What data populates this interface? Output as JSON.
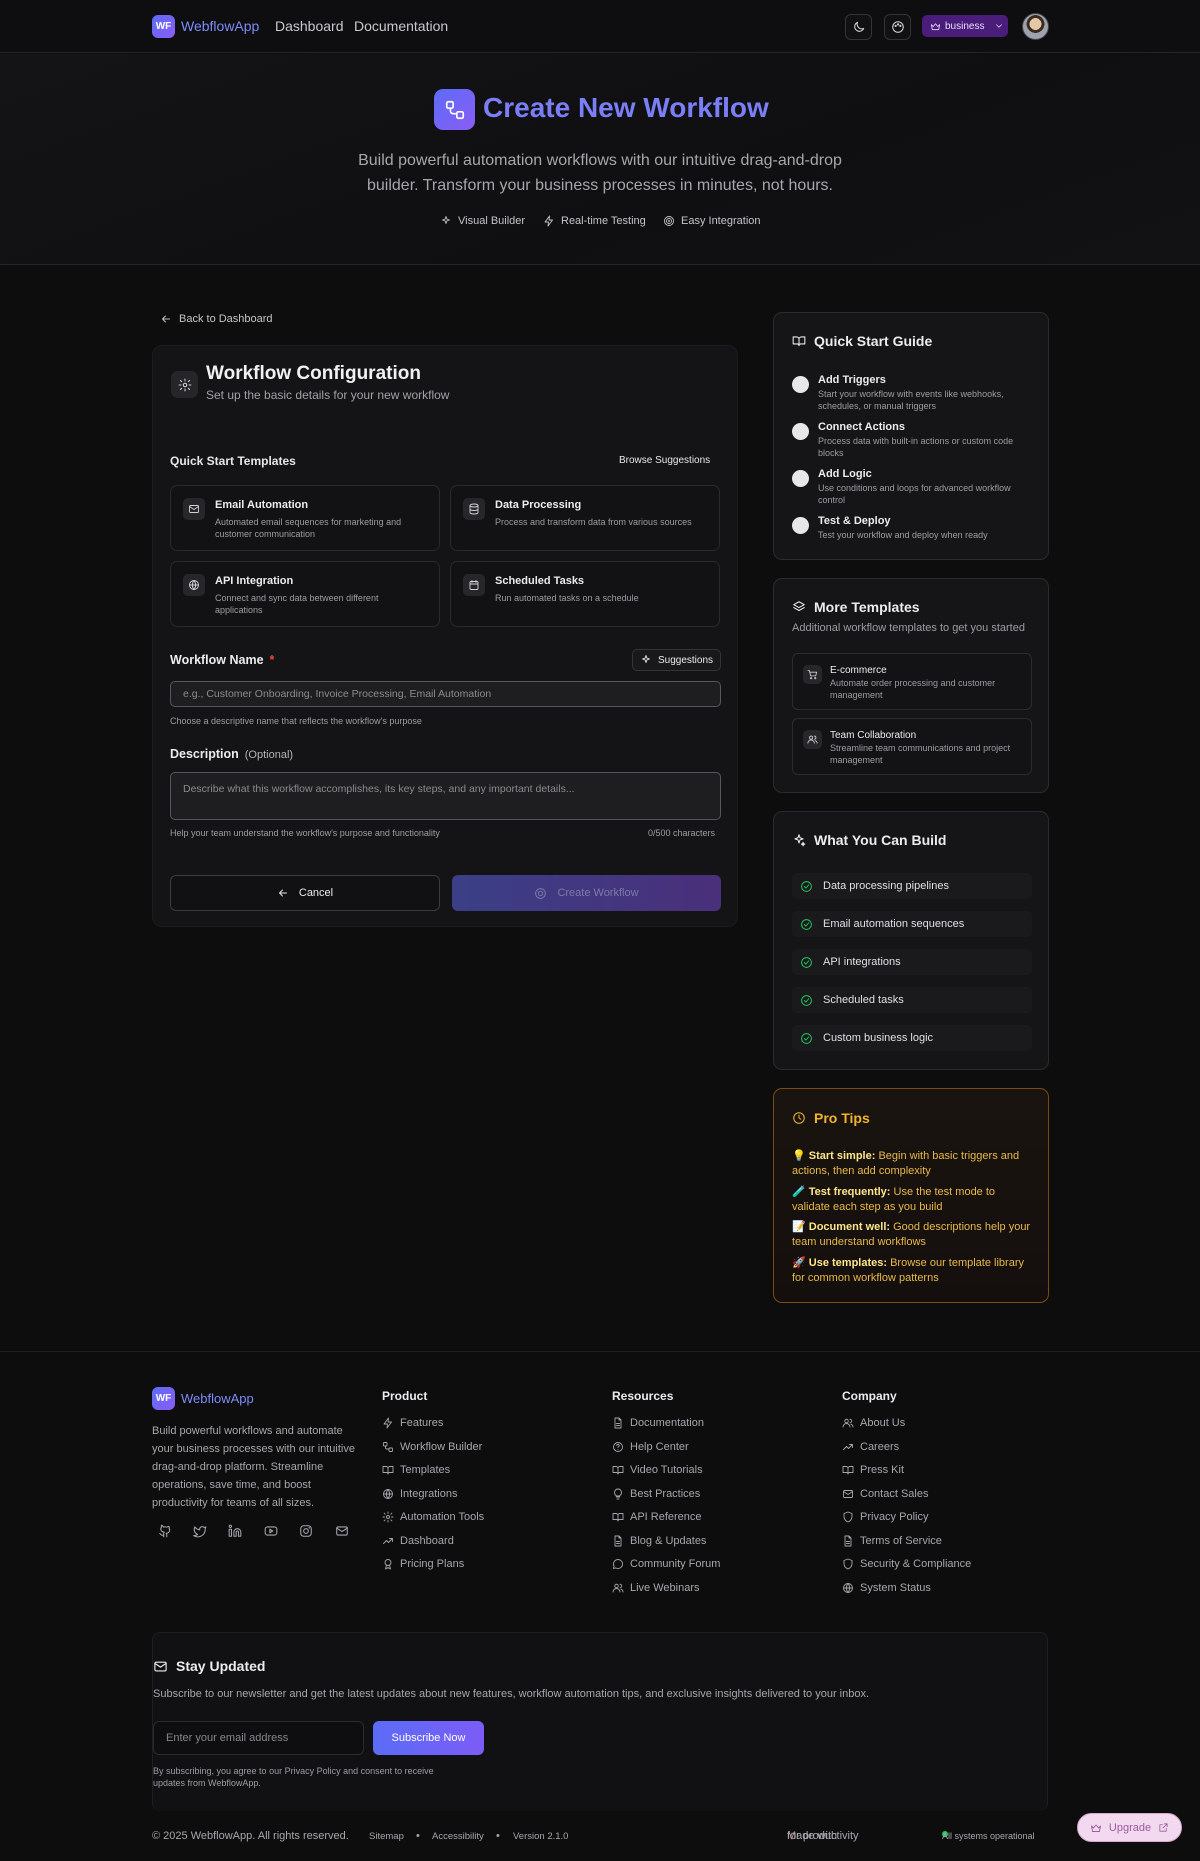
{
  "nav": {
    "logo_abbr": "WF",
    "app_name": "WebflowApp",
    "links": [
      "Dashboard",
      "Documentation"
    ],
    "plan_label": "business"
  },
  "hero": {
    "title": "Create New Workflow",
    "subtitle": "Build powerful automation workflows with our intuitive drag-and-drop builder. Transform your business processes in minutes, not hours.",
    "features": [
      "Visual Builder",
      "Real-time Testing",
      "Easy Integration"
    ]
  },
  "back_link": "Back to Dashboard",
  "config": {
    "title": "Workflow Configuration",
    "subtitle": "Set up the basic details for your new workflow",
    "templates_heading": "Quick Start Templates",
    "browse_label": "Browse Suggestions",
    "templates": [
      {
        "name": "Email Automation",
        "desc": "Automated email sequences for marketing and customer communication",
        "icon": "mail-icon"
      },
      {
        "name": "Data Processing",
        "desc": "Process and transform data from various sources",
        "icon": "database-icon"
      },
      {
        "name": "API Integration",
        "desc": "Connect and sync data between different applications",
        "icon": "globe-icon"
      },
      {
        "name": "Scheduled Tasks",
        "desc": "Run automated tasks on a schedule",
        "icon": "calendar-icon"
      }
    ],
    "name_label": "Workflow Name",
    "required_mark": "*",
    "suggestions_label": "Suggestions",
    "name_placeholder": "e.g., Customer Onboarding, Invoice Processing, Email Automation",
    "name_hint": "Choose a descriptive name that reflects the workflow's purpose",
    "desc_label": "Description",
    "desc_optional": "(Optional)",
    "desc_placeholder": "Describe what this workflow accomplishes, its key steps, and any important details...",
    "desc_hint": "Help your team understand the workflow's purpose and functionality",
    "char_count": "0/500 characters",
    "cancel_label": "Cancel",
    "create_label": "Create Workflow"
  },
  "guide": {
    "title": "Quick Start Guide",
    "steps": [
      {
        "title": "Add Triggers",
        "desc": "Start your workflow with events like webhooks, schedules, or manual triggers"
      },
      {
        "title": "Connect Actions",
        "desc": "Process data with built-in actions or custom code blocks"
      },
      {
        "title": "Add Logic",
        "desc": "Use conditions and loops for advanced workflow control"
      },
      {
        "title": "Test & Deploy",
        "desc": "Test your workflow and deploy when ready"
      }
    ]
  },
  "more_templates": {
    "title": "More Templates",
    "subtitle": "Additional workflow templates to get you started",
    "items": [
      {
        "name": "E-commerce",
        "desc": "Automate order processing and customer management",
        "icon": "cart-icon"
      },
      {
        "name": "Team Collaboration",
        "desc": "Streamline team communications and project management",
        "icon": "users-icon"
      }
    ]
  },
  "build": {
    "title": "What You Can Build",
    "items": [
      "Data processing pipelines",
      "Email automation sequences",
      "API integrations",
      "Scheduled tasks",
      "Custom business logic"
    ]
  },
  "pro_tips": {
    "title": "Pro Tips",
    "tips": [
      {
        "emoji": "💡",
        "bold": "Start simple:",
        "text": "Begin with basic triggers and actions, then add complexity"
      },
      {
        "emoji": "🧪",
        "bold": "Test frequently:",
        "text": "Use the test mode to validate each step as you build"
      },
      {
        "emoji": "📝",
        "bold": "Document well:",
        "text": "Good descriptions help your team understand workflows"
      },
      {
        "emoji": "🚀",
        "bold": "Use templates:",
        "text": "Browse our template library for common workflow patterns"
      }
    ]
  },
  "footer": {
    "logo_abbr": "WF",
    "app_name": "WebflowApp",
    "description": "Build powerful workflows and automate your business processes with our intuitive drag-and-drop platform. Streamline operations, save time, and boost productivity for teams of all sizes.",
    "social_icons": [
      "github-icon",
      "twitter-icon",
      "linkedin-icon",
      "youtube-icon",
      "instagram-icon",
      "mail-icon"
    ],
    "columns": [
      {
        "title": "Product",
        "links": [
          "Features",
          "Workflow Builder",
          "Templates",
          "Integrations",
          "Automation Tools",
          "Dashboard",
          "Pricing Plans"
        ]
      },
      {
        "title": "Resources",
        "links": [
          "Documentation",
          "Help Center",
          "Video Tutorials",
          "Best Practices",
          "API Reference",
          "Blog & Updates",
          "Community Forum",
          "Live Webinars"
        ]
      },
      {
        "title": "Company",
        "links": [
          "About Us",
          "Careers",
          "Press Kit",
          "Contact Sales",
          "Privacy Policy",
          "Terms of Service",
          "Security & Compliance",
          "System Status"
        ]
      }
    ],
    "newsletter": {
      "title": "Stay Updated",
      "subtitle": "Subscribe to our newsletter and get the latest updates about new features, workflow automation tips, and exclusive insights delivered to your inbox.",
      "placeholder": "Enter your email address",
      "button": "Subscribe Now",
      "legal": "By subscribing, you agree to our Privacy Policy and consent to receive updates from WebflowApp."
    },
    "copyright": "© 2025 WebflowApp. All rights reserved.",
    "bottom_links": [
      "Sitemap",
      "Accessibility",
      "Version 2.1.0"
    ],
    "made_with": "Made with",
    "made_for": "for productivity",
    "status": "All systems operational",
    "upgrade_label": "Upgrade"
  },
  "colors": {
    "accent": "#7b7ff7",
    "brand_gradient_start": "#5b6cf6",
    "brand_gradient_end": "#8b5cf6",
    "pro_tips": "#f0b429",
    "success": "#22c55e"
  }
}
